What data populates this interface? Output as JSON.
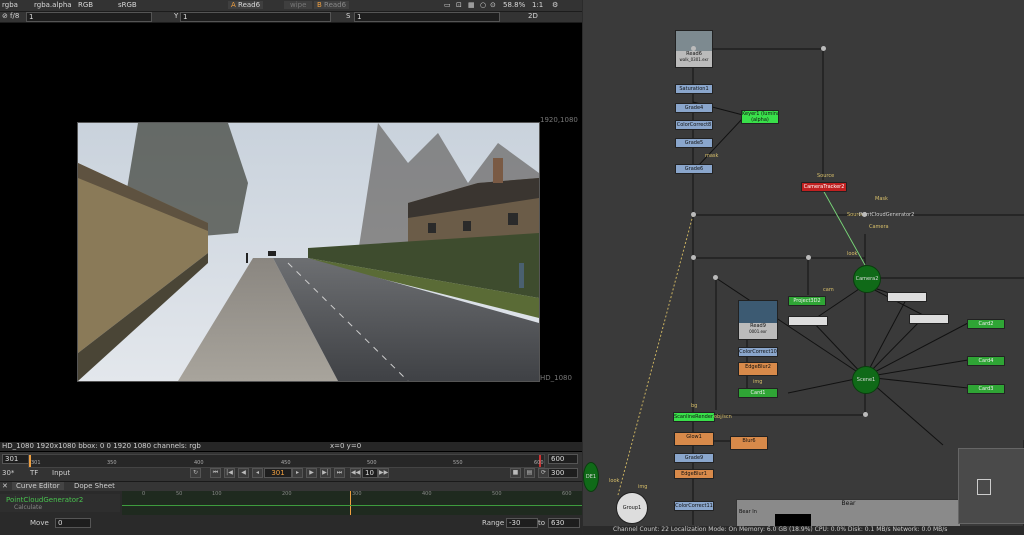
{
  "viewer_toolbar": {
    "channels": "rgba",
    "alpha": "rgba.alpha",
    "colorspace": "RGB",
    "lut": "sRGB",
    "input_a": "Read6",
    "compare_mode": "wipe",
    "input_b": "Read6",
    "zoom": "58.8%",
    "proxy": "1:1"
  },
  "viewer_toolbar2": {
    "fstop": "f/8",
    "gain": "1",
    "gamma_label": "Y",
    "gamma": "1",
    "saturation_label": "S",
    "saturation": "1",
    "view_mode": "2D"
  },
  "viewer": {
    "format_top": "1920,1080",
    "format_bottom": "HD_1080",
    "info": "HD_1080 1920x1080  bbox: 0 0 1920 1080 channels: rgb",
    "coords": "x=0 y=0"
  },
  "timeline": {
    "frame_in": "301",
    "ticks": [
      "301",
      "350",
      "400",
      "450",
      "500",
      "550",
      "600"
    ],
    "frame_out": "600",
    "fps": "30*",
    "tf": "TF",
    "input": "Input",
    "current_frame": "301",
    "skip": "10",
    "end_field": "300"
  },
  "curve_editor": {
    "tab1": "Curve Editor",
    "tab2": "Dope Sheet",
    "tree_item": "PointCloudGenerator2",
    "tree_item2": "Calculate",
    "ruler": [
      "0",
      "50",
      "100",
      "200",
      "300",
      "400",
      "500",
      "600"
    ],
    "move_label": "Move",
    "move_value": "0",
    "range_label": "Range",
    "range_from": "-30",
    "range_to_label": "to",
    "range_to": "630"
  },
  "node_graph": {
    "read6": "Read6",
    "read6_file": "walk_0301.exr",
    "saturation": "Saturation1",
    "grade4": "Grade4",
    "colorcorrect": "ColorCorrect8",
    "grade5": "Grade5",
    "grade6": "Grade6",
    "keyer": "Keyer1 (luminance key)",
    "keyer2": "(alpha)",
    "source": "Source",
    "camera_tracker": "CameraTracker2",
    "mask_label": "Mask",
    "source2": "Source",
    "point_cloud": "PointCloudGenerator2",
    "camera_lbl": "Camera",
    "camera2": "Camera2",
    "project3d": "Project3D2",
    "read9": "Read9",
    "read9_file": "0001.exr",
    "colorcorrect10": "ColorCorrect10",
    "edgeblur2": "EdgeBlur2",
    "card1": "Card1",
    "card2": "Card2",
    "card3": "Card3",
    "card4": "Card4",
    "scene1": "Scene1",
    "scanline": "ScanlineRender1",
    "glow": "Glow1",
    "blur": "Blur6",
    "edgeblur1": "EdgeBlur1",
    "colorcorrect11": "ColorCorrect11",
    "grade": "Grade9",
    "backdrop": "Bear",
    "backdrop_text": "Bear In",
    "camera_small": "cam",
    "img": "img",
    "bg": "bg",
    "obj": "obj/scn",
    "mask": "mask",
    "de": "DE1",
    "group": "Group1",
    "look": "look",
    "source_lbl": "img",
    "status": "Channel Count: 22 Localization Mode: On Memory: 6.0 GB (18.9%) CPU: 0.0% Disk: 0.1 MB/s Network: 0.0 MB/s"
  }
}
